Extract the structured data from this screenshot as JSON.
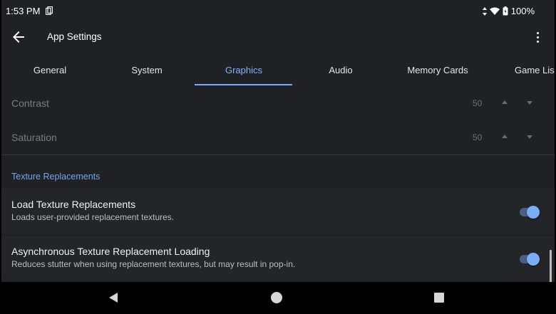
{
  "status_bar": {
    "time": "1:53 PM",
    "battery": "100%"
  },
  "app_bar": {
    "title": "App Settings"
  },
  "tabs": [
    {
      "label": "General"
    },
    {
      "label": "System"
    },
    {
      "label": "Graphics",
      "active": true
    },
    {
      "label": "Audio"
    },
    {
      "label": "Memory Cards"
    },
    {
      "label": "Game Lis"
    }
  ],
  "settings": {
    "contrast": {
      "label": "Contrast",
      "value": "50"
    },
    "saturation": {
      "label": "Saturation",
      "value": "50"
    },
    "section_title": "Texture Replacements",
    "load_texture": {
      "title": "Load Texture Replacements",
      "subtitle": "Loads user-provided replacement textures.",
      "enabled": true
    },
    "async_loading": {
      "title": "Asynchronous Texture Replacement Loading",
      "subtitle": "Reduces stutter when using replacement textures, but may result in pop-in.",
      "enabled": true
    }
  },
  "colors": {
    "accent": "#7cb5ff",
    "switch_thumb": "#7aacf7",
    "background": "#202124"
  }
}
